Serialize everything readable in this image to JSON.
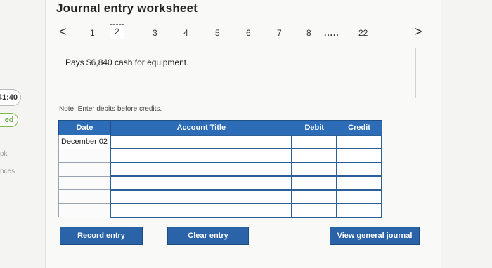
{
  "sidebar": {
    "timer": "41:40",
    "badge": "ed",
    "link_a": "ok",
    "link_b": "nces"
  },
  "worksheet": {
    "title": "Journal entry worksheet",
    "pager": {
      "prev": "<",
      "pages": [
        "1",
        "2",
        "3",
        "4",
        "5",
        "6",
        "7",
        "8"
      ],
      "current": "2",
      "ellipsis": ".....",
      "last": "22",
      "next": ">"
    },
    "description": "Pays $6,840 cash for equipment.",
    "note": "Note: Enter debits before credits.",
    "table": {
      "headers": [
        "Date",
        "Account Title",
        "Debit",
        "Credit"
      ],
      "rows": [
        {
          "date": "December 02"
        },
        {
          "date": ""
        },
        {
          "date": ""
        },
        {
          "date": ""
        },
        {
          "date": ""
        },
        {
          "date": ""
        }
      ]
    },
    "buttons": {
      "record": "Record entry",
      "clear": "Clear entry",
      "view": "View general journal"
    }
  }
}
